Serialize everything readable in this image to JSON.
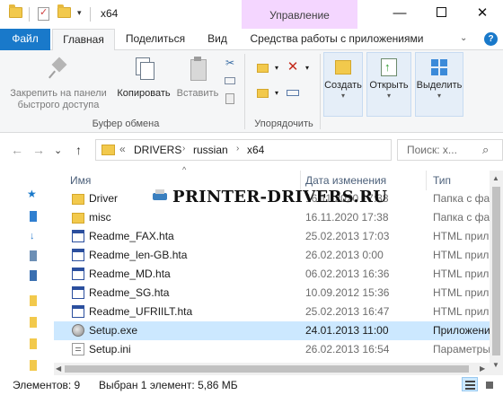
{
  "window": {
    "title": "x64",
    "manage_tab": "Управление",
    "minimize": "—",
    "close": "✕",
    "qa_dropdown": "▾"
  },
  "tabs": {
    "file": "Файл",
    "home": "Главная",
    "share": "Поделиться",
    "view": "Вид",
    "tools": "Средства работы с приложениями",
    "chevron": "⌄",
    "help": "?"
  },
  "ribbon": {
    "pin_line1": "Закрепить на панели",
    "pin_line2": "быстрого доступа",
    "copy": "Копировать",
    "paste": "Вставить",
    "clipboard_group": "Буфер обмена",
    "cut_icon": "✂",
    "delete_icon": "✕",
    "organize_group": "Упорядочить",
    "new": "Создать",
    "open": "Открыть",
    "select": "Выделить",
    "caret": "▾"
  },
  "nav": {
    "back": "←",
    "forward": "→",
    "recent": "⌄",
    "up": "↑"
  },
  "address": {
    "overflow": "«",
    "crumbs": [
      "DRIVERS",
      "russian",
      "x64"
    ],
    "separator": "›",
    "dropdown": "⌄",
    "refresh": "↻"
  },
  "search": {
    "placeholder": "Поиск: x...",
    "icon": "⌕"
  },
  "columns": {
    "name": "Имя",
    "date": "Дата изменения",
    "type": "Тип",
    "sort_caret": "^"
  },
  "files": [
    {
      "name": "Driver",
      "date": "16.11.2020 17:38",
      "type": "Папка с фа",
      "kind": "folder"
    },
    {
      "name": "misc",
      "date": "16.11.2020 17:38",
      "type": "Папка с фа",
      "kind": "folder"
    },
    {
      "name": "Readme_FAX.hta",
      "date": "25.02.2013 17:03",
      "type": "HTML прил",
      "kind": "hta"
    },
    {
      "name": "Readme_len-GB.hta",
      "date": "26.02.2013 0:00",
      "type": "HTML прил",
      "kind": "hta"
    },
    {
      "name": "Readme_MD.hta",
      "date": "06.02.2013 16:36",
      "type": "HTML прил",
      "kind": "hta"
    },
    {
      "name": "Readme_SG.hta",
      "date": "10.09.2012 15:36",
      "type": "HTML прил",
      "kind": "hta"
    },
    {
      "name": "Readme_UFRIILT.hta",
      "date": "25.02.2013 16:47",
      "type": "HTML прил",
      "kind": "hta"
    },
    {
      "name": "Setup.exe",
      "date": "24.01.2013 11:00",
      "type": "Приложени",
      "kind": "exe",
      "selected": true
    },
    {
      "name": "Setup.ini",
      "date": "26.02.2013 16:54",
      "type": "Параметры",
      "kind": "ini"
    }
  ],
  "watermark": "PRINTER-DRIVERS.RU",
  "status": {
    "items": "Элементов: 9",
    "selected": "Выбран 1 элемент: 5,86 МБ"
  },
  "scroll": {
    "up": "▲",
    "down": "▼",
    "left": "◀",
    "right": "▶"
  },
  "colors": {
    "accent": "#1979ca",
    "manage_tab_bg": "#f4d6ff",
    "selection": "#cce8ff",
    "folder": "#f2c94c"
  }
}
